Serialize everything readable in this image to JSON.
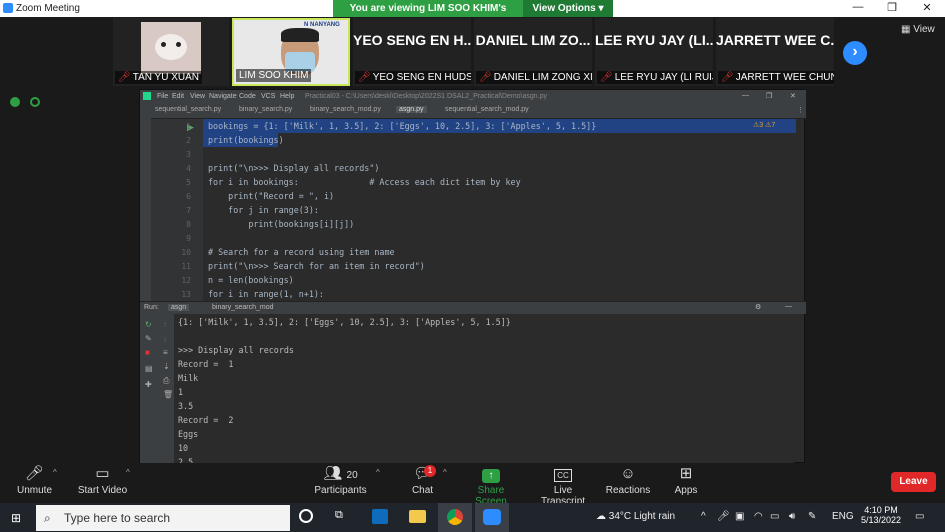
{
  "window": {
    "title": "Zoom Meeting"
  },
  "banner": {
    "viewing": "You are viewing LIM SOO KHIM's screen",
    "view_options": "View Options"
  },
  "strip": {
    "view": "View",
    "tiles": [
      {
        "label": "TAN YU XUAN",
        "name_big": ""
      },
      {
        "label": "LIM SOO KHIM",
        "name_big": ""
      },
      {
        "label": "YEO SENG EN HUDSON",
        "name_big": "YEO SENG EN H..."
      },
      {
        "label": "DANIEL LIM ZONG XIAN",
        "name_big": "DANIEL LIM ZO..."
      },
      {
        "label": "LEE RYU JAY (LI RUIJIE)",
        "name_big": "LEE RYU JAY (LI..."
      },
      {
        "label": "JARRETT WEE CHUNG ...",
        "name_big": "JARRETT WEE C..."
      }
    ]
  },
  "ide": {
    "menu": [
      "File",
      "Edit",
      "View",
      "Navigate",
      "Code",
      "VCS",
      "Help"
    ],
    "path": "Practical03 - C:\\Users\\deski\\Desktop\\2022S1 DSAL2_Practical\\Demo\\asgn.py",
    "tabs": [
      "sequential_search.py",
      "binary_search.py",
      "binary_search_mod.py",
      "asgn.py",
      "sequential_search_mod.py"
    ],
    "warnings": "⚠3 ⚠7",
    "lines": [
      {
        "n": "1",
        "text": "bookings = {1: ['Milk', 1, 3.5], 2: ['Eggs', 10, 2.5], 3: ['Apples', 5, 1.5]}"
      },
      {
        "n": "2",
        "text": "print(bookings)"
      },
      {
        "n": "3",
        "text": ""
      },
      {
        "n": "4",
        "text": "print(\"\\n>>> Display all records\")"
      },
      {
        "n": "5",
        "text": "for i in bookings:              # Access each dict item by key"
      },
      {
        "n": "6",
        "text": "    print(\"Record = \", i)"
      },
      {
        "n": "7",
        "text": "    for j in range(3):"
      },
      {
        "n": "8",
        "text": "        print(bookings[i][j])"
      },
      {
        "n": "9",
        "text": ""
      },
      {
        "n": "10",
        "text": "# Search for a record using item name"
      },
      {
        "n": "11",
        "text": "print(\"\\n>>> Search for an item in record\")"
      },
      {
        "n": "12",
        "text": "n = len(bookings)"
      },
      {
        "n": "13",
        "text": "for i in range(1, n+1):"
      }
    ],
    "run": {
      "label": "Run:",
      "tabs": [
        "asgn",
        "binary_search_mod"
      ]
    },
    "console": [
      "{1: ['Milk', 1, 3.5], 2: ['Eggs', 10, 2.5], 3: ['Apples', 5, 1.5]}",
      "",
      ">>> Display all records",
      "Record =  1",
      "Milk",
      "1",
      "3.5",
      "Record =  2",
      "Eggs",
      "10",
      "2.5"
    ]
  },
  "toolbar": {
    "unmute": "Unmute",
    "start_video": "Start Video",
    "participants": "Participants",
    "participants_count": "20",
    "chat": "Chat",
    "chat_badge": "1",
    "share": "Share Screen",
    "transcript": "Live Transcript",
    "reactions": "Reactions",
    "apps": "Apps",
    "leave": "Leave"
  },
  "taskbar": {
    "search_placeholder": "Type here to search",
    "weather": "34°C  Light rain",
    "lang": "ENG",
    "time": "4:10 PM",
    "date": "5/13/2022"
  }
}
